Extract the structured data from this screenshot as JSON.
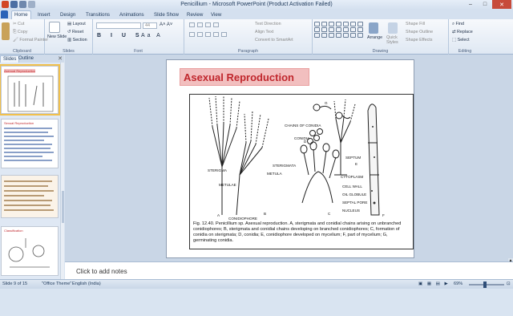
{
  "window": {
    "title": "Penicillium - Microsoft PowerPoint (Product Activation Failed)",
    "minimize": "–",
    "maximize": "□",
    "close": "✕"
  },
  "tabs": [
    "Home",
    "Insert",
    "Design",
    "Transitions",
    "Animations",
    "Slide Show",
    "Review",
    "View"
  ],
  "ribbon": {
    "clipboard": {
      "label": "Clipboard",
      "paste": "Paste",
      "cut": "Cut",
      "copy": "Copy",
      "format_painter": "Format Painter"
    },
    "slides": {
      "label": "Slides",
      "new_slide": "New Slide",
      "layout": "Layout",
      "reset": "Reset",
      "section": "Section"
    },
    "font": {
      "label": "Font",
      "size": "44"
    },
    "paragraph": {
      "label": "Paragraph",
      "text_direction": "Text Direction",
      "align_text": "Align Text",
      "convert_smartart": "Convert to SmartArt"
    },
    "drawing": {
      "label": "Drawing",
      "arrange": "Arrange",
      "quick_styles": "Quick Styles",
      "shape_fill": "Shape Fill",
      "shape_outline": "Shape Outline",
      "shape_effects": "Shape Effects"
    },
    "editing": {
      "label": "Editing",
      "find": "Find",
      "replace": "Replace",
      "select": "Select"
    }
  },
  "left_pane": {
    "tabs": [
      "Slides",
      "Outline"
    ],
    "thumb_titles": [
      "Asexual Reproduction",
      "Sexual Reproduction",
      "",
      "Classification"
    ]
  },
  "slide": {
    "title": "Asexual Reproduction",
    "figure_labels": {
      "chains": "CHAINS OF CONIDIA",
      "conidia": "CONIDIA",
      "sterigmata": "STERIGMATA",
      "metula": "METULA",
      "sterigma": "STERIGMA",
      "metulae": "METULAE",
      "conidiophore": "CONIDIOPHORE",
      "septum": "SEPTUM",
      "cytoplasm": "CYTOPLASM",
      "cell_wall": "CELL WALL",
      "oil_globule": "OIL GLOBULE",
      "septal_pore": "SEPTAL PORE",
      "nucleus": "NUCLEUS",
      "a": "A",
      "b": "B",
      "c": "C",
      "d": "D",
      "e": "E",
      "f": "F",
      "g": "G"
    },
    "caption": "Fig. 12.40. Penicillium sp. Asexual reproduction. A, sterigmata and conidial chains arising on unbranched conidiophores; B, sterigmata and conidial chains developing on branched conidiophores; C, formation of conidia on sterigmata; D, conidia; E, conidiophore developed on mycelium; F, part of mycelium; G, germinating conidia."
  },
  "notes": {
    "placeholder": "Click to add notes"
  },
  "status": {
    "slide": "Slide 9 of 15",
    "theme": "\"Office Theme\"",
    "language": "English (India)",
    "zoom": "69%"
  },
  "colors": {
    "title_bg": "#f2bfbf",
    "title_text": "#c0272d",
    "file_tab": "#2a63b8"
  }
}
